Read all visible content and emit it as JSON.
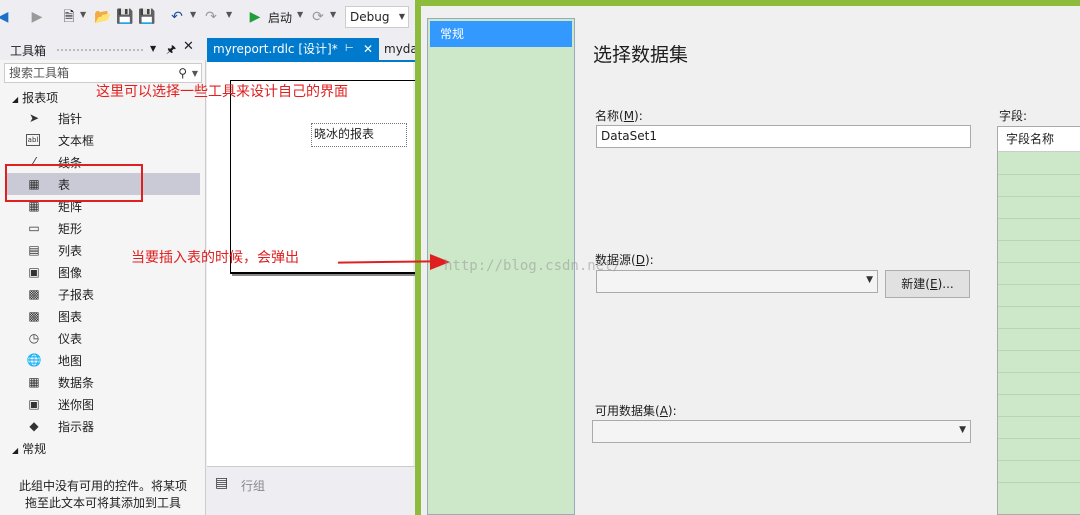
{
  "toolbar": {
    "start_label": "启动",
    "config_value": "Debug"
  },
  "toolbox": {
    "title": "工具箱",
    "search_placeholder": "搜索工具箱",
    "report_items_group": "报表项",
    "items": [
      {
        "label": "指针",
        "icon": "pointer-icon"
      },
      {
        "label": "文本框",
        "icon": "textbox-icon"
      },
      {
        "label": "线条",
        "icon": "line-icon"
      },
      {
        "label": "表",
        "icon": "table-icon"
      },
      {
        "label": "矩阵",
        "icon": "matrix-icon"
      },
      {
        "label": "矩形",
        "icon": "rectangle-icon"
      },
      {
        "label": "列表",
        "icon": "list-icon"
      },
      {
        "label": "图像",
        "icon": "image-icon"
      },
      {
        "label": "子报表",
        "icon": "subreport-icon"
      },
      {
        "label": "图表",
        "icon": "chart-icon"
      },
      {
        "label": "仪表",
        "icon": "gauge-icon"
      },
      {
        "label": "地图",
        "icon": "map-icon"
      },
      {
        "label": "数据条",
        "icon": "databar-icon"
      },
      {
        "label": "迷你图",
        "icon": "sparkline-icon"
      },
      {
        "label": "指示器",
        "icon": "indicator-icon"
      }
    ],
    "general_group": "常规",
    "footer_line1": "此组中没有可用的控件。将某项",
    "footer_line2": "拖至此文本可将其添加到工具"
  },
  "designer": {
    "tab_active": "myreport.rdlc [设计]*",
    "tab_second": "myda",
    "textbox_value": "晓冰的报表",
    "groups_label": "行组"
  },
  "dialog": {
    "nav_item": "常规",
    "title": "选择数据集",
    "name_label": "名称(",
    "name_key": "M",
    "name_suffix": "):",
    "name_value": "DataSet1",
    "fields_label": "字段:",
    "fields_header": "字段名称",
    "datasource_label": "数据源(",
    "datasource_key": "D",
    "datasource_suffix": "):",
    "new_button_label": "新建(",
    "new_button_key": "E",
    "new_button_suffix": ")...",
    "available_label": "可用数据集(",
    "available_key": "A",
    "available_suffix": "):"
  },
  "annotations": {
    "note1": "这里可以选择一些工具来设计自己的界面",
    "note2": "当要插入表的时候，会弹出",
    "watermark": "http://blog.csdn.net/",
    "accent_color": "#e02020"
  }
}
